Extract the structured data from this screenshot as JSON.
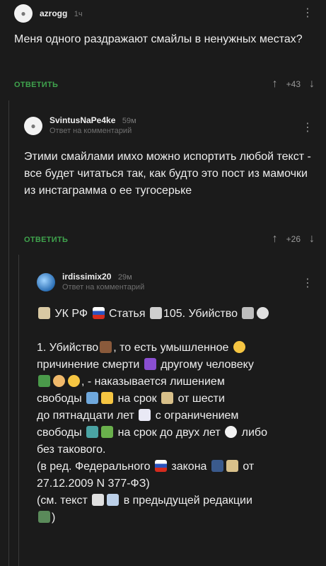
{
  "comments": [
    {
      "username": "azrogg",
      "time": "1ч",
      "text": "Меня одного раздражают смайлы в ненужных местах?",
      "reply_label": "ОТВЕТИТЬ",
      "rating": "+43"
    },
    {
      "username": "SvintusNaPe4ke",
      "time": "59м",
      "reply_to": "Ответ на комментарий",
      "text": "Этими смайлами имхо можно испортить любой текст - все будет читаться так, как будто это пост из мамочки из инстаграмма о ее тугосерьке",
      "reply_label": "ОТВЕТИТЬ",
      "rating": "+26"
    },
    {
      "username": "irdissimix20",
      "time": "29м",
      "reply_to": "Ответ на комментарий",
      "lines": {
        "l1a": "УК РФ",
        "l1b": "Статья",
        "l1c": "105. Убийство",
        "l2a": "1. Убийство",
        "l2b": ", то есть умышленное",
        "l3a": "причинение смерти",
        "l3b": "другому человеку",
        "l4": ", - наказывается лишением",
        "l5a": "свободы",
        "l5b": "на срок",
        "l5c": "от шести",
        "l6a": "до пятнадцати лет",
        "l6b": "с ограничением",
        "l7a": "свободы",
        "l7b": "на срок до двух лет",
        "l7c": "либо",
        "l8": "без такового.",
        "l9a": "(в ред. Федерального",
        "l9b": "закона",
        "l9c": "от",
        "l10": "27.12.2009 N 377-ФЗ)",
        "l11a": "(см. текст",
        "l11b": "в предыдущей редакции",
        "l12": ")"
      }
    }
  ],
  "icons": {
    "more": "⋮",
    "up": "↑",
    "down": "↓"
  },
  "colors": {
    "background": "#1b1b1b",
    "reply_green": "#3fa34d",
    "thread_line": "#3a3a3a"
  }
}
